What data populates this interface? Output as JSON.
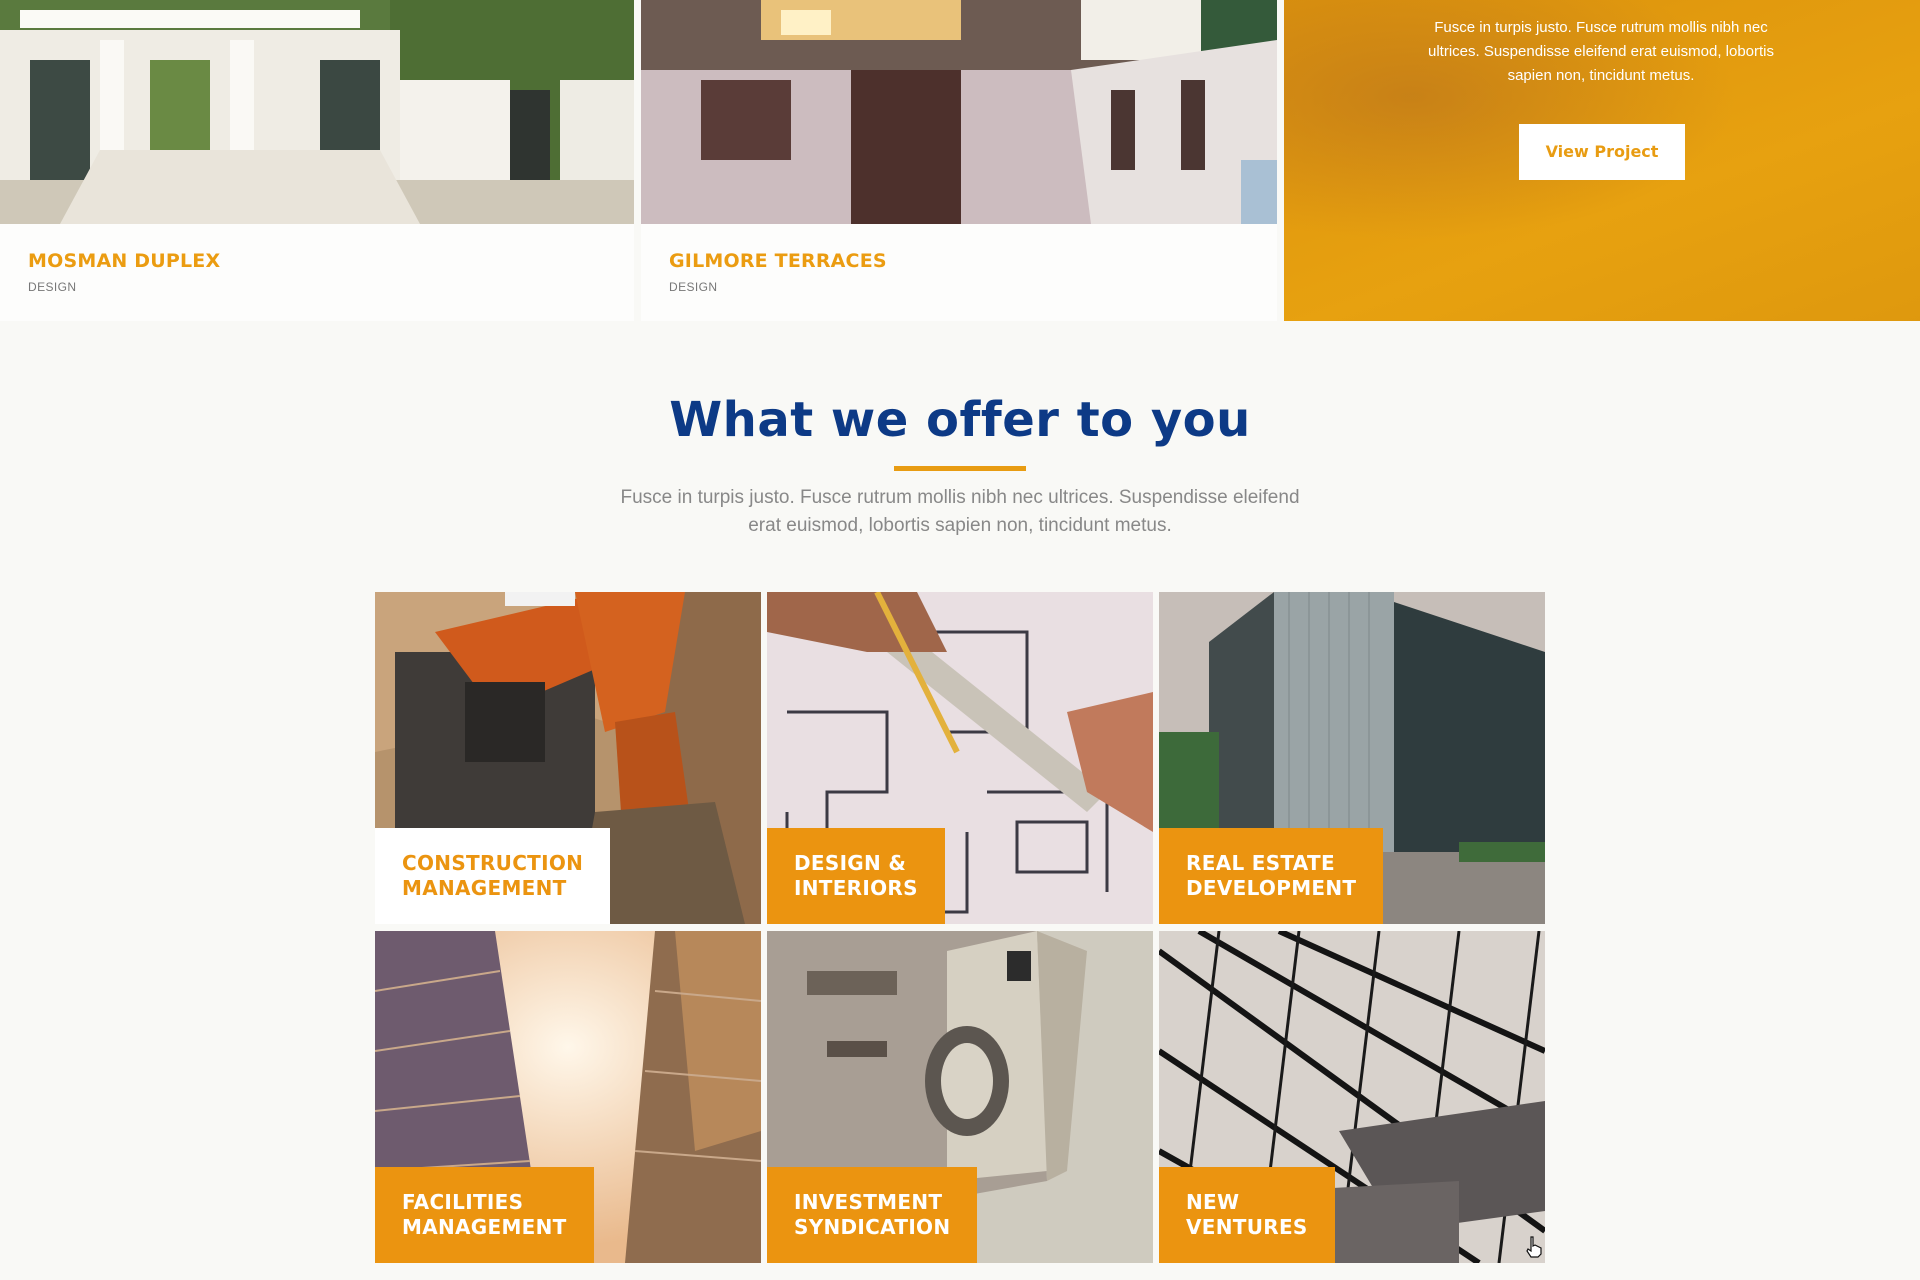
{
  "projects": [
    {
      "title": "MOSMAN DUPLEX",
      "category": "DESIGN"
    },
    {
      "title": "GILMORE TERRACES",
      "category": "DESIGN"
    }
  ],
  "featured": {
    "description": "Fusce in turpis justo. Fusce rutrum mollis nibh nec ultrices. Suspendisse eleifend erat euismod, lobortis sapien non, tincidunt metus.",
    "button_label": "View  Project"
  },
  "offer": {
    "title": "What we offer to you",
    "description": "Fusce in turpis justo. Fusce rutrum mollis nibh nec ultrices. Suspendisse eleifend erat euismod, lobortis sapien non, tincidunt metus.",
    "services": [
      {
        "label": "CONSTRUCTION\nMANAGEMENT",
        "image": "excavator"
      },
      {
        "label": "DESIGN &\nINTERIORS",
        "image": "floor-plan-drawing"
      },
      {
        "label": "REAL ESTATE\nDEVELOPMENT",
        "image": "office-building"
      },
      {
        "label": "FACILITIES\nMANAGEMENT",
        "image": "skyscrapers"
      },
      {
        "label": "INVESTMENT\nSYNDICATION",
        "image": "banknote"
      },
      {
        "label": "NEW\nVENTURES",
        "image": "glass-roof"
      }
    ]
  },
  "colors": {
    "accent": "#eb9410",
    "title": "#0d3a86",
    "background": "#f9f9f6"
  }
}
